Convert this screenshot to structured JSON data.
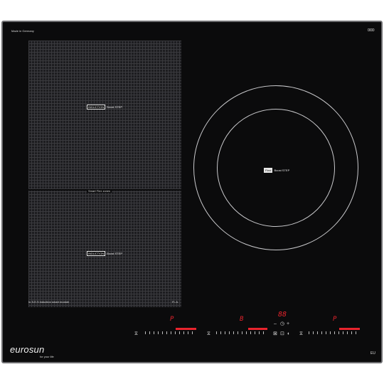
{
  "product": {
    "made_in": "Made in Germany",
    "series_note": "In S.E.S induction smart module",
    "brand": "eurosun",
    "tagline": "for your life",
    "model_code": "EU",
    "corner_code": "0000"
  },
  "flex_zone": {
    "top_badge": {
      "left": "INDUCTION",
      "right": "Boost STEP"
    },
    "divider_label": "Smart Flex zones",
    "bottom_badge": {
      "left": "INDUCTION",
      "right": "Boost STEP"
    },
    "corner_mark": "Fl. A"
  },
  "round_zone": {
    "badge": {
      "left": "Flexi",
      "right": "Boost STEP"
    }
  },
  "controls": {
    "left": {
      "display": "P",
      "power_fraction": 0.62
    },
    "middle": {
      "display": "B",
      "power_fraction": 0.58
    },
    "timer": {
      "display": "88",
      "minus": "–",
      "plus": "+"
    },
    "right": {
      "display": "P",
      "power_fraction": 0.62
    }
  },
  "colors": {
    "accent": "#e8242d",
    "glass": "#0b0b0c",
    "frame": "#6d6d70"
  },
  "icons": [
    "flex-zone-icon",
    "timer-icon",
    "lock-icon",
    "power-icon"
  ]
}
